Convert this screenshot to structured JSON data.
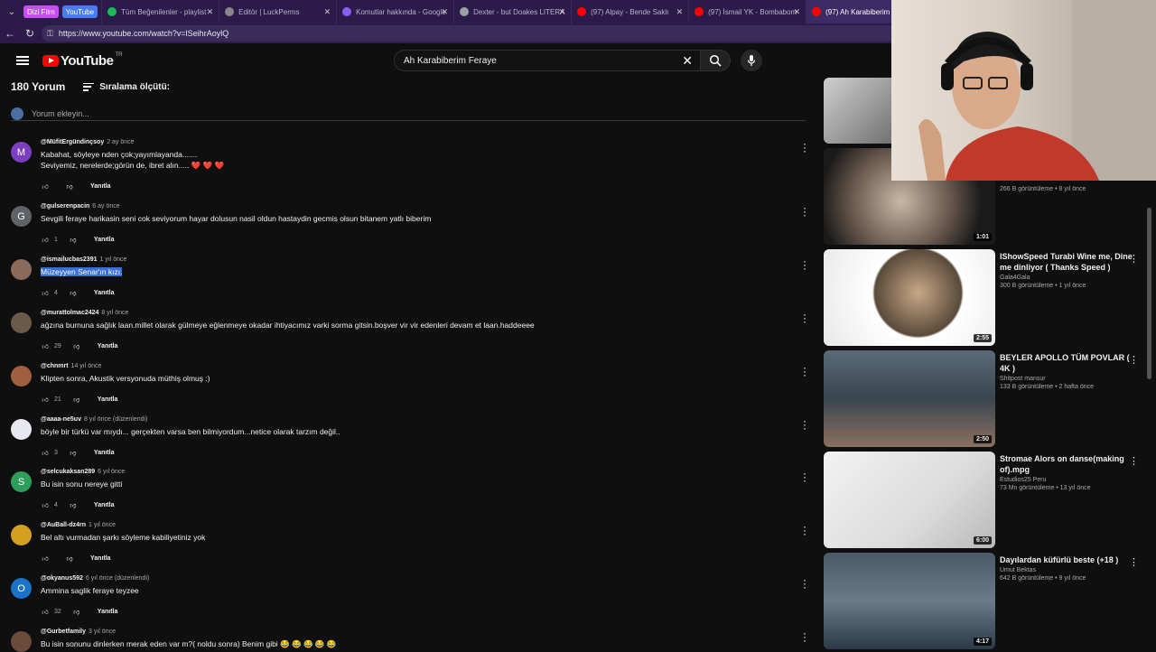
{
  "browser": {
    "group_labels": [
      "Dizi Film",
      "YouTube"
    ],
    "group_colors": [
      "#c94df0",
      "#4a7bf7"
    ],
    "tabs": [
      {
        "label": "Tüm Beğenilenler - playlist",
        "icon": "spotify-icon",
        "color": "#1db954"
      },
      {
        "label": "Editör | LuckPerms",
        "icon": "luckperms-icon",
        "color": "#888888"
      },
      {
        "label": "Komutlar hakkında - Google",
        "icon": "docs-icon",
        "color": "#8a5cf6"
      },
      {
        "label": "Dexter - but Doakes LITERA",
        "icon": "globe-icon",
        "color": "#9aa0a6"
      },
      {
        "label": "(97) Alpay - Bende Saklı",
        "icon": "youtube-icon",
        "color": "#ff0000"
      },
      {
        "label": "(97) İsmail YK - Bombabom",
        "icon": "youtube-icon",
        "color": "#ff0000"
      },
      {
        "label": "(97) Ah Karabiberim Fera",
        "icon": "youtube-icon",
        "color": "#ff0000"
      }
    ],
    "url": "https://www.youtube.com/watch?v=lSeihrAoylQ"
  },
  "youtube": {
    "logo_text": "YouTube",
    "region": "TR",
    "search_value": "Ah Karabiberim Feraye"
  },
  "comments_header": {
    "count": "180 Yorum",
    "sort_label": "Sıralama ölçütü:",
    "add_placeholder": "Yorum ekleyin..."
  },
  "comments": [
    {
      "handle": "@MüfitErgündinçsoy",
      "time": "2 ay önce",
      "lines": [
        "Kabahat, söyleye nden çok;yayımlayanda.......",
        "Seviyemiz, nerelerde;görün de, ibret alın..... ❤️ ❤️ ❤️"
      ],
      "likes": "",
      "reply": "Yanıtla",
      "avatar_letter": "M",
      "avatar_color": "#7b3fbf"
    },
    {
      "handle": "@gulserenpacin",
      "time": "6 ay önce",
      "lines": [
        "Sevgili feraye harikasin seni cok seviyorum hayar dolusun nasil oldun hastaydin gecmis olsun bitanem yatlı biberim"
      ],
      "likes": "1",
      "reply": "Yanıtla",
      "avatar_letter": "G",
      "avatar_color": "#5f6368"
    },
    {
      "handle": "@ismailucbas2391",
      "time": "1 yıl önce",
      "lines": [
        "Müzeyyen Senar'ın kızı."
      ],
      "likes": "4",
      "reply": "Yanıtla",
      "avatar_letter": "",
      "avatar_color": "#8a6a5a"
    },
    {
      "handle": "@murattolmac2424",
      "time": "8 yıl önce",
      "lines": [
        "ağzına burnuna sağlık laan.millet olarak gülmeye eğlenmeye okadar ihtiyacımız varki sorma gitsin.boşver vir vir edenleri devam et laan.haddeeee"
      ],
      "likes": "29",
      "reply": "Yanıtla",
      "avatar_letter": "",
      "avatar_color": "#6a5a4a"
    },
    {
      "handle": "@chnmrt",
      "time": "14 yıl önce",
      "lines": [
        "Klipten sonra, Akustik versyonuda müthiş olmuş :)"
      ],
      "likes": "21",
      "reply": "Yanıtla",
      "avatar_letter": "",
      "avatar_color": "#a06040"
    },
    {
      "handle": "@aaaa-ne5uv",
      "time": "8 yıl önce (düzenlendi)",
      "lines": [
        "böyle bir türkü var mıydı... gerçekten varsa ben bilmiyordum...netice olarak tarzım değil.."
      ],
      "likes": "3",
      "reply": "Yanıtla",
      "avatar_letter": "",
      "avatar_color": "#e8e8f0"
    },
    {
      "handle": "@selcukaksan289",
      "time": "6 yıl önce",
      "lines": [
        "Bu isin sonu nereye gitti"
      ],
      "likes": "4",
      "reply": "Yanıtla",
      "avatar_letter": "S",
      "avatar_color": "#2e9e5b"
    },
    {
      "handle": "@AuBall-dz4rn",
      "time": "1 yıl önce",
      "lines": [
        "Bel altı vurmadan şarkı söyleme kabiliyetiniz yok"
      ],
      "likes": "",
      "reply": "Yanıtla",
      "avatar_letter": "",
      "avatar_color": "#d4a020"
    },
    {
      "handle": "@okyanus592",
      "time": "6 yıl önce (düzenlendi)",
      "lines": [
        "Ammina saglik ferayе teyzee"
      ],
      "likes": "32",
      "reply": "Yanıtla",
      "avatar_letter": "O",
      "avatar_color": "#1a73c8"
    },
    {
      "handle": "@Gurbetfamily",
      "time": "3 yıl önce",
      "lines": [
        "Bu isin sonunu dinlerken merak eden var m?( noldu sonra) Benim gibi 😂 😂 😂 😂 😂"
      ],
      "likes": "",
      "reply": "",
      "avatar_letter": "",
      "avatar_color": "#6a4a3a"
    }
  ],
  "recommendations": [
    {
      "title": "",
      "channel": "",
      "stats": "",
      "duration": "",
      "thumb_color": "#3a3a3a"
    },
    {
      "title": "",
      "channel": "",
      "stats": "266 B görüntüleme • 8 yıl önce",
      "duration": "1:01",
      "thumb_color": "#5a4a40"
    },
    {
      "title": "IShowSpeed Turabi Wine me, Dine me dinliyor ( Thanks Speed )",
      "channel": "Gala4Gala",
      "stats": "300 B görüntüleme • 1 yıl önce",
      "duration": "2:55",
      "thumb_color": "#6a5a4a"
    },
    {
      "title": "BEYLER APOLLO TÜM POVLAR ( 4K )",
      "channel": "Shitpost mansur",
      "stats": "133 B görüntüleme • 2 hafta önce",
      "duration": "2:50",
      "thumb_color": "#4a5a6a"
    },
    {
      "title": "Stromae  Alors on danse(making of).mpg",
      "channel": "Estudios25 Peru",
      "stats": "73 Mn görüntüleme • 13 yıl önce",
      "duration": "6:00",
      "thumb_color": "#d8d8d8"
    },
    {
      "title": "Dayılardan küfürlü beste (+18 )",
      "channel": "Umut Bektas",
      "stats": "642 B görüntüleme • 9 yıl önce",
      "duration": "4:17",
      "thumb_color": "#3a4a5a"
    }
  ]
}
